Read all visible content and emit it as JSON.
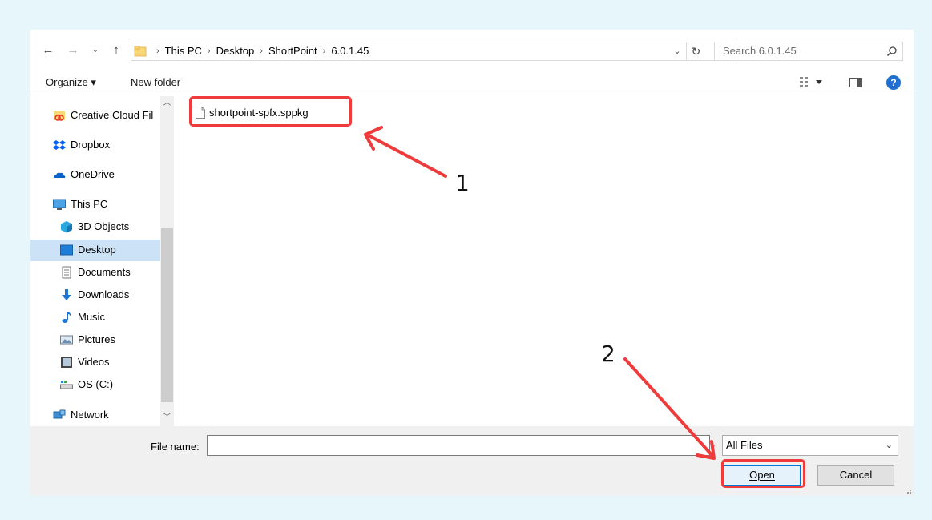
{
  "address": {
    "crumbs": [
      "This PC",
      "Desktop",
      "ShortPoint",
      "6.0.1.45"
    ],
    "search_placeholder": "Search 6.0.1.45"
  },
  "toolbar": {
    "organize_label": "Organize ▾",
    "new_folder_label": "New folder",
    "help_label": "?"
  },
  "nav": {
    "items": [
      {
        "label": "Creative Cloud Fil",
        "icon": "creative-cloud-icon"
      },
      {
        "label": "Dropbox",
        "icon": "dropbox-icon"
      },
      {
        "label": "OneDrive",
        "icon": "onedrive-icon"
      },
      {
        "label": "This PC",
        "icon": "computer-icon"
      },
      {
        "label": "3D Objects",
        "icon": "3d-objects-icon"
      },
      {
        "label": "Desktop",
        "icon": "desktop-icon",
        "selected": true
      },
      {
        "label": "Documents",
        "icon": "documents-icon"
      },
      {
        "label": "Downloads",
        "icon": "downloads-icon"
      },
      {
        "label": "Music",
        "icon": "music-icon"
      },
      {
        "label": "Pictures",
        "icon": "pictures-icon"
      },
      {
        "label": "Videos",
        "icon": "videos-icon"
      },
      {
        "label": "OS (C:)",
        "icon": "drive-icon"
      },
      {
        "label": "Network",
        "icon": "network-icon"
      }
    ]
  },
  "files": [
    {
      "name": "shortpoint-spfx.sppkg",
      "icon": "file-icon"
    }
  ],
  "bottom": {
    "file_name_label": "File name:",
    "file_name_value": "",
    "file_type": "All Files",
    "open_label": "Open",
    "cancel_label": "Cancel"
  },
  "annotations": {
    "step1": "1",
    "step2": "2",
    "color": "#ef3b3b"
  }
}
